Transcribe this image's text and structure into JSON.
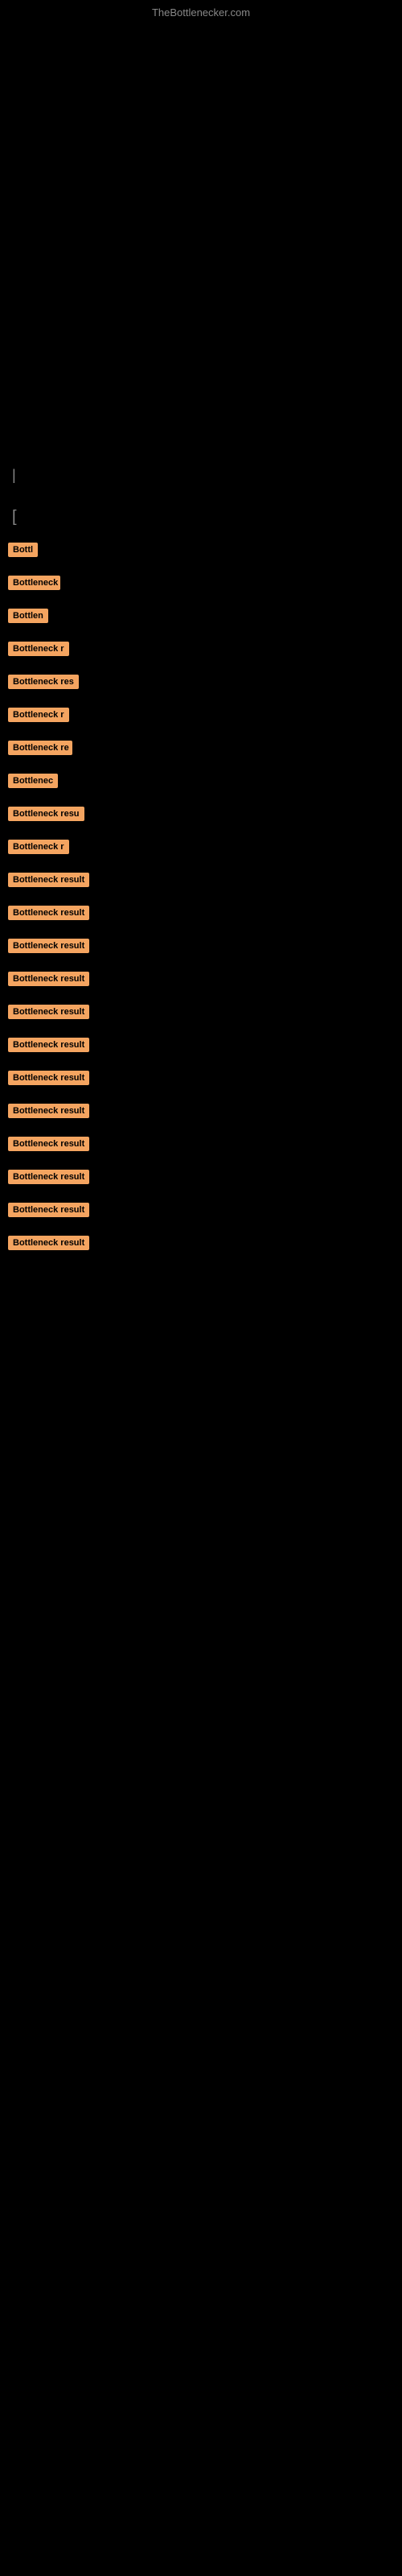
{
  "site": {
    "title": "TheBottlenecker.com"
  },
  "content": {
    "cursor": "|",
    "section_marker": "[",
    "bottleneck_items": [
      {
        "id": 1,
        "label": "Bottleneck result",
        "badge_class": "badge-xs",
        "display": "Bottl"
      },
      {
        "id": 2,
        "label": "Bottleneck result",
        "badge_class": "badge-sm",
        "display": "Bottleneck"
      },
      {
        "id": 3,
        "label": "Bottleneck result",
        "badge_class": "badge-sm",
        "display": "Bottlen"
      },
      {
        "id": 4,
        "label": "Bottleneck result",
        "badge_class": "badge-md",
        "display": "Bottleneck r"
      },
      {
        "id": 5,
        "label": "Bottleneck result",
        "badge_class": "badge-lg",
        "display": "Bottleneck res"
      },
      {
        "id": 6,
        "label": "Bottleneck result",
        "badge_class": "badge-md",
        "display": "Bottleneck r"
      },
      {
        "id": 7,
        "label": "Bottleneck result",
        "badge_class": "badge-md",
        "display": "Bottleneck re"
      },
      {
        "id": 8,
        "label": "Bottleneck result",
        "badge_class": "badge-sm",
        "display": "Bottlenec"
      },
      {
        "id": 9,
        "label": "Bottleneck result",
        "badge_class": "badge-lg",
        "display": "Bottleneck resu"
      },
      {
        "id": 10,
        "label": "Bottleneck result",
        "badge_class": "badge-md",
        "display": "Bottleneck r"
      },
      {
        "id": 11,
        "label": "Bottleneck result",
        "badge_class": "badge-xl",
        "display": "Bottleneck result"
      },
      {
        "id": 12,
        "label": "Bottleneck result",
        "badge_class": "badge-xl",
        "display": "Bottleneck result"
      },
      {
        "id": 13,
        "label": "Bottleneck result",
        "badge_class": "badge-xl",
        "display": "Bottleneck result"
      },
      {
        "id": 14,
        "label": "Bottleneck result",
        "badge_class": "badge-xl",
        "display": "Bottleneck result"
      },
      {
        "id": 15,
        "label": "Bottleneck result",
        "badge_class": "badge-xl",
        "display": "Bottleneck result"
      },
      {
        "id": 16,
        "label": "Bottleneck result",
        "badge_class": "badge-xl",
        "display": "Bottleneck result"
      },
      {
        "id": 17,
        "label": "Bottleneck result",
        "badge_class": "badge-xl",
        "display": "Bottleneck result"
      },
      {
        "id": 18,
        "label": "Bottleneck result",
        "badge_class": "badge-xl",
        "display": "Bottleneck result"
      },
      {
        "id": 19,
        "label": "Bottleneck result",
        "badge_class": "badge-xl",
        "display": "Bottleneck result"
      },
      {
        "id": 20,
        "label": "Bottleneck result",
        "badge_class": "badge-xl",
        "display": "Bottleneck result"
      },
      {
        "id": 21,
        "label": "Bottleneck result",
        "badge_class": "badge-xl",
        "display": "Bottleneck result"
      },
      {
        "id": 22,
        "label": "Bottleneck result",
        "badge_class": "badge-xl",
        "display": "Bottleneck result"
      }
    ]
  },
  "colors": {
    "background": "#000000",
    "badge_bg": "#f4a460",
    "badge_text": "#000000",
    "site_title": "#888888"
  }
}
